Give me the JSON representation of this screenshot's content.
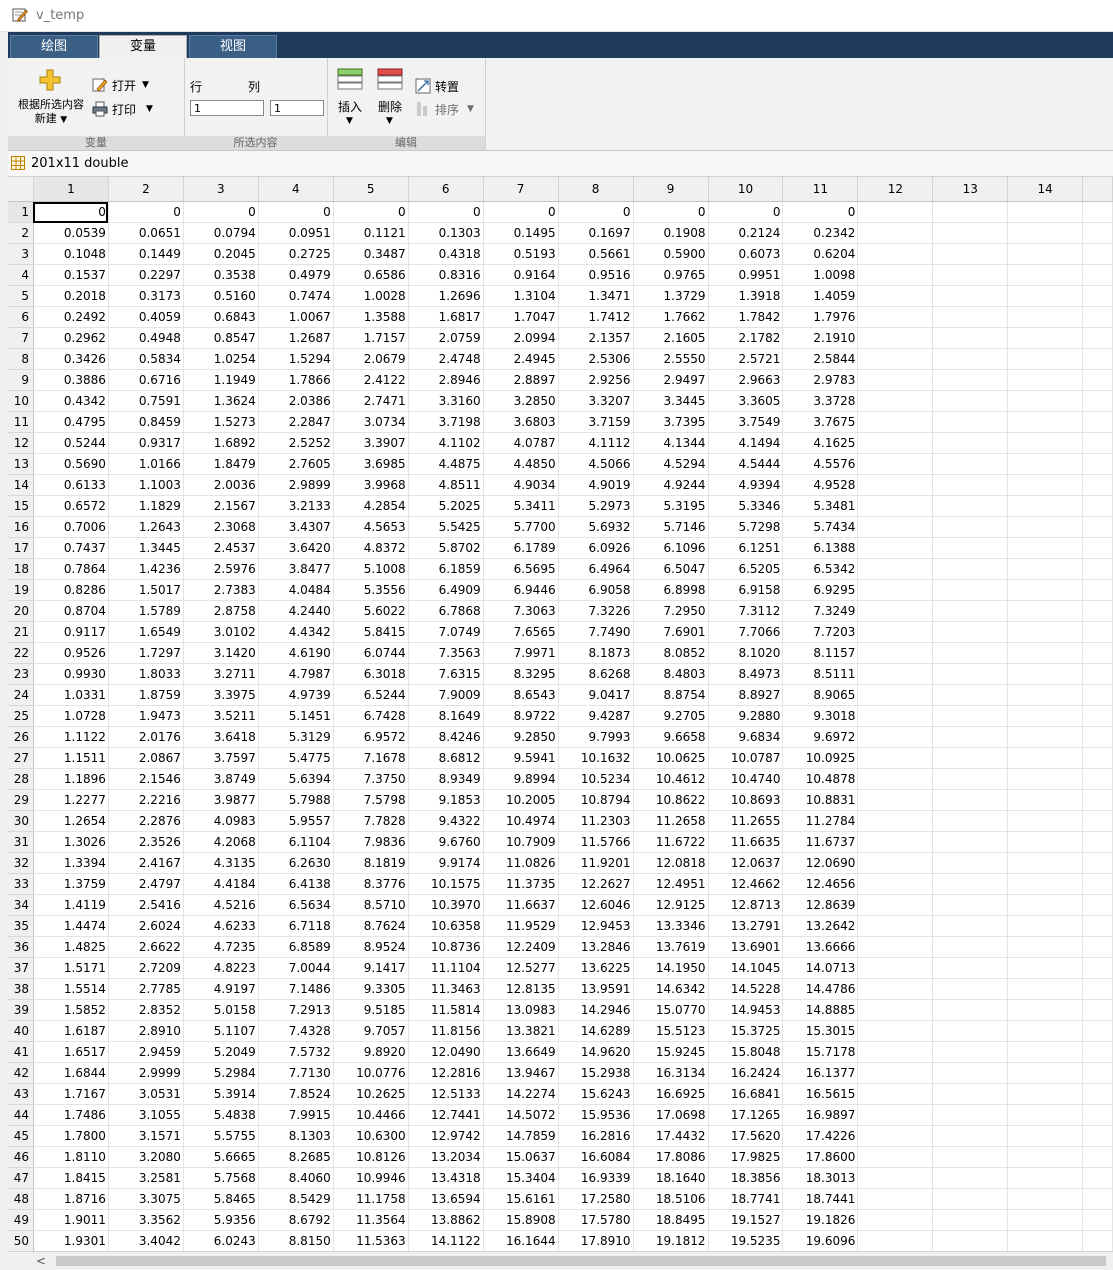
{
  "window": {
    "title": "v_temp"
  },
  "tabs": [
    {
      "label": "绘图",
      "active": false
    },
    {
      "label": "变量",
      "active": true
    },
    {
      "label": "视图",
      "active": false
    }
  ],
  "ribbon": {
    "variable_group": {
      "label": "变量",
      "new_from_selection": "根据所选内容\n新建",
      "new_from_selection_line1": "根据所选内容",
      "new_from_selection_line2": "新建",
      "open": "打开",
      "print": "打印"
    },
    "selection_group": {
      "label": "所选内容",
      "row_label": "行",
      "col_label": "列",
      "row_value": "1",
      "col_value": "1"
    },
    "edit_group": {
      "label": "编辑",
      "insert": "插入",
      "delete": "删除",
      "transpose": "转置",
      "sort": "排序"
    }
  },
  "variable_info": {
    "size_type": "201x11 double"
  },
  "grid": {
    "columns": [
      "1",
      "2",
      "3",
      "4",
      "5",
      "6",
      "7",
      "8",
      "9",
      "10",
      "11",
      "12",
      "13",
      "14"
    ],
    "rows": [
      [
        "0",
        "0",
        "0",
        "0",
        "0",
        "0",
        "0",
        "0",
        "0",
        "0",
        "0"
      ],
      [
        "0.0539",
        "0.0651",
        "0.0794",
        "0.0951",
        "0.1121",
        "0.1303",
        "0.1495",
        "0.1697",
        "0.1908",
        "0.2124",
        "0.2342"
      ],
      [
        "0.1048",
        "0.1449",
        "0.2045",
        "0.2725",
        "0.3487",
        "0.4318",
        "0.5193",
        "0.5661",
        "0.5900",
        "0.6073",
        "0.6204"
      ],
      [
        "0.1537",
        "0.2297",
        "0.3538",
        "0.4979",
        "0.6586",
        "0.8316",
        "0.9164",
        "0.9516",
        "0.9765",
        "0.9951",
        "1.0098"
      ],
      [
        "0.2018",
        "0.3173",
        "0.5160",
        "0.7474",
        "1.0028",
        "1.2696",
        "1.3104",
        "1.3471",
        "1.3729",
        "1.3918",
        "1.4059"
      ],
      [
        "0.2492",
        "0.4059",
        "0.6843",
        "1.0067",
        "1.3588",
        "1.6817",
        "1.7047",
        "1.7412",
        "1.7662",
        "1.7842",
        "1.7976"
      ],
      [
        "0.2962",
        "0.4948",
        "0.8547",
        "1.2687",
        "1.7157",
        "2.0759",
        "2.0994",
        "2.1357",
        "2.1605",
        "2.1782",
        "2.1910"
      ],
      [
        "0.3426",
        "0.5834",
        "1.0254",
        "1.5294",
        "2.0679",
        "2.4748",
        "2.4945",
        "2.5306",
        "2.5550",
        "2.5721",
        "2.5844"
      ],
      [
        "0.3886",
        "0.6716",
        "1.1949",
        "1.7866",
        "2.4122",
        "2.8946",
        "2.8897",
        "2.9256",
        "2.9497",
        "2.9663",
        "2.9783"
      ],
      [
        "0.4342",
        "0.7591",
        "1.3624",
        "2.0386",
        "2.7471",
        "3.3160",
        "3.2850",
        "3.3207",
        "3.3445",
        "3.3605",
        "3.3728"
      ],
      [
        "0.4795",
        "0.8459",
        "1.5273",
        "2.2847",
        "3.0734",
        "3.7198",
        "3.6803",
        "3.7159",
        "3.7395",
        "3.7549",
        "3.7675"
      ],
      [
        "0.5244",
        "0.9317",
        "1.6892",
        "2.5252",
        "3.3907",
        "4.1102",
        "4.0787",
        "4.1112",
        "4.1344",
        "4.1494",
        "4.1625"
      ],
      [
        "0.5690",
        "1.0166",
        "1.8479",
        "2.7605",
        "3.6985",
        "4.4875",
        "4.4850",
        "4.5066",
        "4.5294",
        "4.5444",
        "4.5576"
      ],
      [
        "0.6133",
        "1.1003",
        "2.0036",
        "2.9899",
        "3.9968",
        "4.8511",
        "4.9034",
        "4.9019",
        "4.9244",
        "4.9394",
        "4.9528"
      ],
      [
        "0.6572",
        "1.1829",
        "2.1567",
        "3.2133",
        "4.2854",
        "5.2025",
        "5.3411",
        "5.2973",
        "5.3195",
        "5.3346",
        "5.3481"
      ],
      [
        "0.7006",
        "1.2643",
        "2.3068",
        "3.4307",
        "4.5653",
        "5.5425",
        "5.7700",
        "5.6932",
        "5.7146",
        "5.7298",
        "5.7434"
      ],
      [
        "0.7437",
        "1.3445",
        "2.4537",
        "3.6420",
        "4.8372",
        "5.8702",
        "6.1789",
        "6.0926",
        "6.1096",
        "6.1251",
        "6.1388"
      ],
      [
        "0.7864",
        "1.4236",
        "2.5976",
        "3.8477",
        "5.1008",
        "6.1859",
        "6.5695",
        "6.4964",
        "6.5047",
        "6.5205",
        "6.5342"
      ],
      [
        "0.8286",
        "1.5017",
        "2.7383",
        "4.0484",
        "5.3556",
        "6.4909",
        "6.9446",
        "6.9058",
        "6.8998",
        "6.9158",
        "6.9295"
      ],
      [
        "0.8704",
        "1.5789",
        "2.8758",
        "4.2440",
        "5.6022",
        "6.7868",
        "7.3063",
        "7.3226",
        "7.2950",
        "7.3112",
        "7.3249"
      ],
      [
        "0.9117",
        "1.6549",
        "3.0102",
        "4.4342",
        "5.8415",
        "7.0749",
        "7.6565",
        "7.7490",
        "7.6901",
        "7.7066",
        "7.7203"
      ],
      [
        "0.9526",
        "1.7297",
        "3.1420",
        "4.6190",
        "6.0744",
        "7.3563",
        "7.9971",
        "8.1873",
        "8.0852",
        "8.1020",
        "8.1157"
      ],
      [
        "0.9930",
        "1.8033",
        "3.2711",
        "4.7987",
        "6.3018",
        "7.6315",
        "8.3295",
        "8.6268",
        "8.4803",
        "8.4973",
        "8.5111"
      ],
      [
        "1.0331",
        "1.8759",
        "3.3975",
        "4.9739",
        "6.5244",
        "7.9009",
        "8.6543",
        "9.0417",
        "8.8754",
        "8.8927",
        "8.9065"
      ],
      [
        "1.0728",
        "1.9473",
        "3.5211",
        "5.1451",
        "6.7428",
        "8.1649",
        "8.9722",
        "9.4287",
        "9.2705",
        "9.2880",
        "9.3018"
      ],
      [
        "1.1122",
        "2.0176",
        "3.6418",
        "5.3129",
        "6.9572",
        "8.4246",
        "9.2850",
        "9.7993",
        "9.6658",
        "9.6834",
        "9.6972"
      ],
      [
        "1.1511",
        "2.0867",
        "3.7597",
        "5.4775",
        "7.1678",
        "8.6812",
        "9.5941",
        "10.1632",
        "10.0625",
        "10.0787",
        "10.0925"
      ],
      [
        "1.1896",
        "2.1546",
        "3.8749",
        "5.6394",
        "7.3750",
        "8.9349",
        "9.8994",
        "10.5234",
        "10.4612",
        "10.4740",
        "10.4878"
      ],
      [
        "1.2277",
        "2.2216",
        "3.9877",
        "5.7988",
        "7.5798",
        "9.1853",
        "10.2005",
        "10.8794",
        "10.8622",
        "10.8693",
        "10.8831"
      ],
      [
        "1.2654",
        "2.2876",
        "4.0983",
        "5.9557",
        "7.7828",
        "9.4322",
        "10.4974",
        "11.2303",
        "11.2658",
        "11.2655",
        "11.2784"
      ],
      [
        "1.3026",
        "2.3526",
        "4.2068",
        "6.1104",
        "7.9836",
        "9.6760",
        "10.7909",
        "11.5766",
        "11.6722",
        "11.6635",
        "11.6737"
      ],
      [
        "1.3394",
        "2.4167",
        "4.3135",
        "6.2630",
        "8.1819",
        "9.9174",
        "11.0826",
        "11.9201",
        "12.0818",
        "12.0637",
        "12.0690"
      ],
      [
        "1.3759",
        "2.4797",
        "4.4184",
        "6.4138",
        "8.3776",
        "10.1575",
        "11.3735",
        "12.2627",
        "12.4951",
        "12.4662",
        "12.4656"
      ],
      [
        "1.4119",
        "2.5416",
        "4.5216",
        "6.5634",
        "8.5710",
        "10.3970",
        "11.6637",
        "12.6046",
        "12.9125",
        "12.8713",
        "12.8639"
      ],
      [
        "1.4474",
        "2.6024",
        "4.6233",
        "6.7118",
        "8.7624",
        "10.6358",
        "11.9529",
        "12.9453",
        "13.3346",
        "13.2791",
        "13.2642"
      ],
      [
        "1.4825",
        "2.6622",
        "4.7235",
        "6.8589",
        "8.9524",
        "10.8736",
        "12.2409",
        "13.2846",
        "13.7619",
        "13.6901",
        "13.6666"
      ],
      [
        "1.5171",
        "2.7209",
        "4.8223",
        "7.0044",
        "9.1417",
        "11.1104",
        "12.5277",
        "13.6225",
        "14.1950",
        "14.1045",
        "14.0713"
      ],
      [
        "1.5514",
        "2.7785",
        "4.9197",
        "7.1486",
        "9.3305",
        "11.3463",
        "12.8135",
        "13.9591",
        "14.6342",
        "14.5228",
        "14.4786"
      ],
      [
        "1.5852",
        "2.8352",
        "5.0158",
        "7.2913",
        "9.5185",
        "11.5814",
        "13.0983",
        "14.2946",
        "15.0770",
        "14.9453",
        "14.8885"
      ],
      [
        "1.6187",
        "2.8910",
        "5.1107",
        "7.4328",
        "9.7057",
        "11.8156",
        "13.3821",
        "14.6289",
        "15.5123",
        "15.3725",
        "15.3015"
      ],
      [
        "1.6517",
        "2.9459",
        "5.2049",
        "7.5732",
        "9.8920",
        "12.0490",
        "13.6649",
        "14.9620",
        "15.9245",
        "15.8048",
        "15.7178"
      ],
      [
        "1.6844",
        "2.9999",
        "5.2984",
        "7.7130",
        "10.0776",
        "12.2816",
        "13.9467",
        "15.2938",
        "16.3134",
        "16.2424",
        "16.1377"
      ],
      [
        "1.7167",
        "3.0531",
        "5.3914",
        "7.8524",
        "10.2625",
        "12.5133",
        "14.2274",
        "15.6243",
        "16.6925",
        "16.6841",
        "16.5615"
      ],
      [
        "1.7486",
        "3.1055",
        "5.4838",
        "7.9915",
        "10.4466",
        "12.7441",
        "14.5072",
        "15.9536",
        "17.0698",
        "17.1265",
        "16.9897"
      ],
      [
        "1.7800",
        "3.1571",
        "5.5755",
        "8.1303",
        "10.6300",
        "12.9742",
        "14.7859",
        "16.2816",
        "17.4432",
        "17.5620",
        "17.4226"
      ],
      [
        "1.8110",
        "3.2080",
        "5.6665",
        "8.2685",
        "10.8126",
        "13.2034",
        "15.0637",
        "16.6084",
        "17.8086",
        "17.9825",
        "17.8600"
      ],
      [
        "1.8415",
        "3.2581",
        "5.7568",
        "8.4060",
        "10.9946",
        "13.4318",
        "15.3404",
        "16.9339",
        "18.1640",
        "18.3856",
        "18.3013"
      ],
      [
        "1.8716",
        "3.3075",
        "5.8465",
        "8.5429",
        "11.1758",
        "13.6594",
        "15.6161",
        "17.2580",
        "18.5106",
        "18.7741",
        "18.7441"
      ],
      [
        "1.9011",
        "3.3562",
        "5.9356",
        "8.6792",
        "11.3564",
        "13.8862",
        "15.8908",
        "17.5780",
        "18.8495",
        "19.1527",
        "19.1826"
      ],
      [
        "1.9301",
        "3.4042",
        "6.0243",
        "8.8150",
        "11.5363",
        "14.1122",
        "16.1644",
        "17.8910",
        "19.1812",
        "19.5235",
        "19.6096"
      ]
    ]
  }
}
